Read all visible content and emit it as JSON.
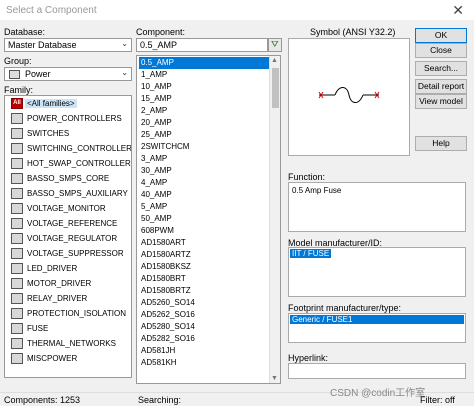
{
  "window": {
    "title": "Select a Component"
  },
  "database": {
    "label": "Database:",
    "value": "Master Database"
  },
  "group": {
    "label": "Group:",
    "value": "Power"
  },
  "family": {
    "label": "Family:",
    "items": [
      "<All families>",
      "POWER_CONTROLLERS",
      "SWITCHES",
      "SWITCHING_CONTROLLER",
      "HOT_SWAP_CONTROLLER",
      "BASSO_SMPS_CORE",
      "BASSO_SMPS_AUXILIARY",
      "VOLTAGE_MONITOR",
      "VOLTAGE_REFERENCE",
      "VOLTAGE_REGULATOR",
      "VOLTAGE_SUPPRESSOR",
      "LED_DRIVER",
      "MOTOR_DRIVER",
      "RELAY_DRIVER",
      "PROTECTION_ISOLATION",
      "FUSE",
      "THERMAL_NETWORKS",
      "MISCPOWER"
    ],
    "all_icon_text": "All"
  },
  "component": {
    "label": "Component:",
    "value": "0.5_AMP",
    "items": [
      "0.5_AMP",
      "1_AMP",
      "10_AMP",
      "15_AMP",
      "2_AMP",
      "20_AMP",
      "25_AMP",
      "2SWITCHCM",
      "3_AMP",
      "30_AMP",
      "4_AMP",
      "40_AMP",
      "5_AMP",
      "50_AMP",
      "608PWM",
      "AD1580ART",
      "AD1580ARTZ",
      "AD1580BKSZ",
      "AD1580BRT",
      "AD1580BRTZ",
      "AD5260_SO14",
      "AD5262_SO16",
      "AD5280_SO14",
      "AD5282_SO16",
      "AD581JH",
      "AD581KH"
    ]
  },
  "symbol": {
    "label": "Symbol (ANSI Y32.2)"
  },
  "buttons": {
    "ok": "OK",
    "close": "Close",
    "search": "Search...",
    "detail_report": "Detail report",
    "view_model": "View model",
    "help": "Help"
  },
  "function": {
    "label": "Function:",
    "value": "0.5 Amp Fuse"
  },
  "model": {
    "label": "Model manufacturer/ID:",
    "value": "IIT / FUSE"
  },
  "footprint": {
    "label": "Footprint manufacturer/type:",
    "value": "Generic / FUSE1"
  },
  "hyperlink": {
    "label": "Hyperlink:"
  },
  "status": {
    "components": "Components: 1253",
    "searching": "Searching:",
    "filter": "Filter: off"
  },
  "watermark": "CSDN @codin工作室",
  "colors": {
    "selection": "#0078d7",
    "all_icon": "#c00000"
  }
}
